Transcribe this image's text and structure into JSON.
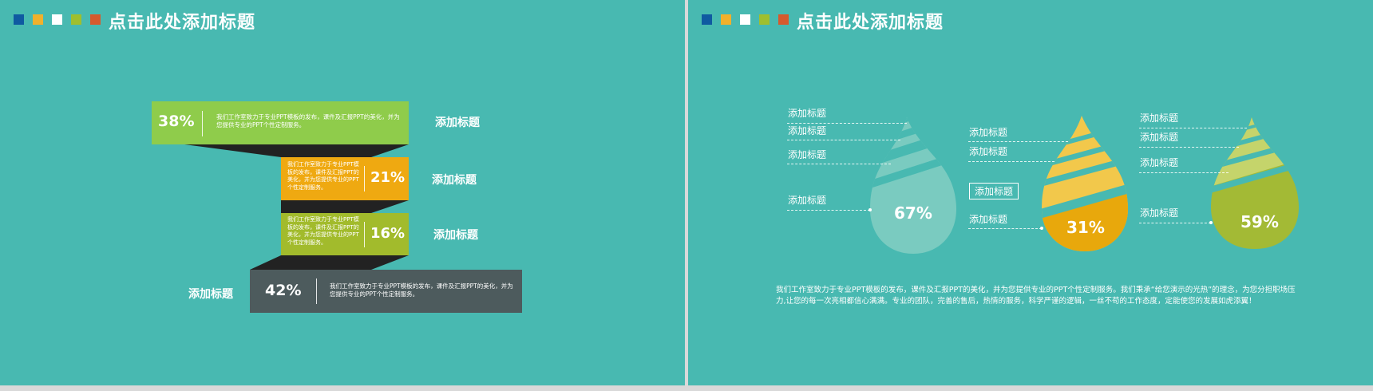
{
  "slides": {
    "left": {
      "title": "点击此处添加标题",
      "header_dots": [
        "#0f5aa1",
        "#f1b12c",
        "#ffffff",
        "#9fbf2e",
        "#d55a2e"
      ],
      "bars": [
        {
          "percent": "38%",
          "text": "我们工作室致力于专业PPT模板的发布，课件及汇报PPT的美化，并为您提供专业的PPT个性定制服务。",
          "label": "添加标题",
          "color": "#8fcc4b"
        },
        {
          "percent": "21%",
          "text": "我们工作室致力于专业PPT模板的发布，课件及汇报PPT的美化，并为您提供专业的PPT个性定制服务。",
          "label": "添加标题",
          "color": "#efa911"
        },
        {
          "percent": "16%",
          "text": "我们工作室致力于专业PPT模板的发布，课件及汇报PPT的美化，并为您提供专业的PPT个性定制服务。",
          "label": "添加标题",
          "color": "#a2bb2c"
        },
        {
          "percent": "42%",
          "text": "我们工作室致力于专业PPT模板的发布，课件及汇报PPT的美化，并为您提供专业的PPT个性定制服务。",
          "label": "添加标题",
          "color": "#4d5b5d"
        }
      ],
      "fold_color": "#222222"
    },
    "right": {
      "title": "点击此处添加标题",
      "header_dots": [
        "#0f5aa1",
        "#f1b12c",
        "#ffffff",
        "#9fbf2e",
        "#d55a2e"
      ],
      "drops": [
        {
          "percent": "67%",
          "labels": [
            "添加标题",
            "添加标题",
            "添加标题",
            "添加标题"
          ],
          "color": "#7acbc0"
        },
        {
          "percent": "31%",
          "labels": [
            "添加标题",
            "添加标题",
            "添加标题",
            "添加标题"
          ],
          "color": "#f2c84b",
          "bottom_color": "#e8a80c"
        },
        {
          "percent": "59%",
          "labels": [
            "添加标题",
            "添加标题",
            "添加标题",
            "添加标题"
          ],
          "color": "#c5d46b",
          "bottom_color": "#a3ba35"
        }
      ],
      "body_text": "我们工作室致力于专业PPT模板的发布，课件及汇报PPT的美化，并为您提供专业的PPT个性定制服务。我们秉承“给您演示的光热”的理念，为您分担职场压力,让您的每一次亮相都信心满满。专业的团队，完善的售后，热情的服务，科学严谨的逻辑，一丝不苟的工作态度，定能使您的发展如虎添翼！"
    }
  }
}
